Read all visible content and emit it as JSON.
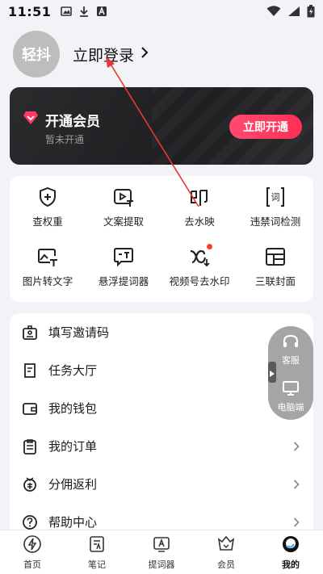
{
  "status_bar": {
    "time": "11:51"
  },
  "profile": {
    "avatar_text": "轻抖",
    "login_label": "立即登录"
  },
  "vip": {
    "title": "开通会员",
    "subtitle": "暂未开通",
    "button": "立即开通"
  },
  "tools": [
    {
      "label": "查权重",
      "icon": "shield-plus-icon"
    },
    {
      "label": "文案提取",
      "icon": "video-text-icon"
    },
    {
      "label": "去水映",
      "icon": "stamp-icon"
    },
    {
      "label": "违禁词检测",
      "icon": "word-check-icon"
    },
    {
      "label": "图片转文字",
      "icon": "image-text-icon"
    },
    {
      "label": "悬浮提词器",
      "icon": "prompter-icon"
    },
    {
      "label": "视频号去水印",
      "icon": "channels-watermark-icon"
    },
    {
      "label": "三联封面",
      "icon": "triple-cover-icon"
    }
  ],
  "list": [
    {
      "label": "填写邀请码",
      "icon": "invite-card-icon"
    },
    {
      "label": "任务大厅",
      "icon": "task-icon"
    },
    {
      "label": "我的钱包",
      "icon": "wallet-icon"
    },
    {
      "label": "我的订单",
      "icon": "order-icon"
    },
    {
      "label": "分佣返利",
      "icon": "commission-icon"
    },
    {
      "label": "帮助中心",
      "icon": "help-icon"
    }
  ],
  "float_panel": {
    "service": "客服",
    "desktop": "电脑端"
  },
  "nav": [
    {
      "label": "首页",
      "icon": "home-bolt-icon"
    },
    {
      "label": "笔记",
      "icon": "note-icon"
    },
    {
      "label": "提词器",
      "icon": "prompter-nav-icon"
    },
    {
      "label": "会员",
      "icon": "crown-icon"
    },
    {
      "label": "我的",
      "icon": "me-icon"
    }
  ],
  "colors": {
    "accent": "#ff3358",
    "card_dark": "#242427",
    "annotation": "#e53935"
  }
}
